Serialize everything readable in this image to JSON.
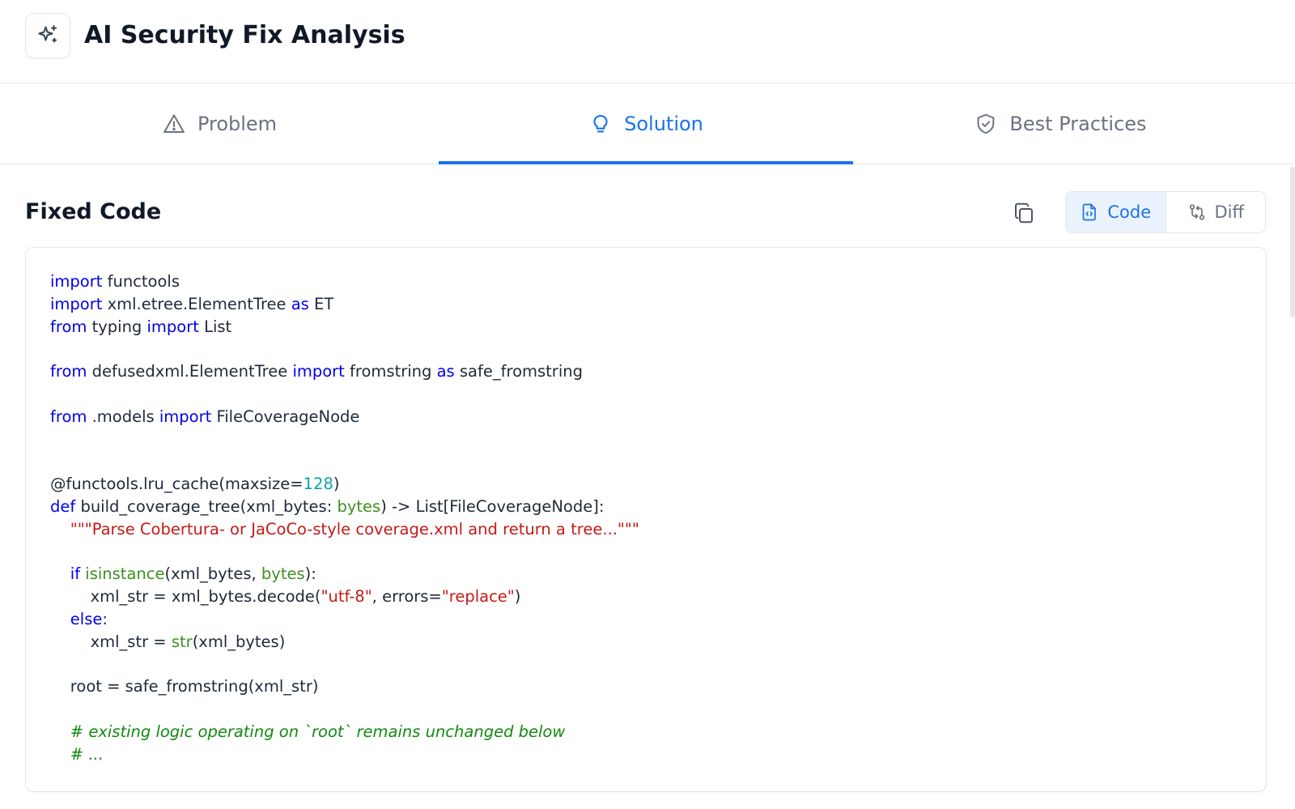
{
  "header": {
    "title": "AI Security Fix Analysis",
    "icon": "sparkle-icon"
  },
  "tabs": [
    {
      "label": "Problem",
      "icon": "warning-triangle-icon",
      "active": false
    },
    {
      "label": "Solution",
      "icon": "lightbulb-icon",
      "active": true
    },
    {
      "label": "Best Practices",
      "icon": "shield-check-icon",
      "active": false
    }
  ],
  "fixed_code": {
    "title": "Fixed Code",
    "copy_icon": "copy-icon",
    "view_toggle": [
      {
        "label": "Code",
        "icon": "file-code-icon",
        "active": true
      },
      {
        "label": "Diff",
        "icon": "git-compare-icon",
        "active": false
      }
    ],
    "lines": [
      [
        {
          "t": "import",
          "c": "kw"
        },
        {
          "t": " functools"
        }
      ],
      [
        {
          "t": "import",
          "c": "kw"
        },
        {
          "t": " xml.etree.ElementTree "
        },
        {
          "t": "as",
          "c": "kw"
        },
        {
          "t": " ET"
        }
      ],
      [
        {
          "t": "from",
          "c": "kw"
        },
        {
          "t": " typing "
        },
        {
          "t": "import",
          "c": "kw"
        },
        {
          "t": " List"
        }
      ],
      [],
      [
        {
          "t": "from",
          "c": "kw"
        },
        {
          "t": " defusedxml.ElementTree "
        },
        {
          "t": "import",
          "c": "kw"
        },
        {
          "t": " fromstring "
        },
        {
          "t": "as",
          "c": "kw"
        },
        {
          "t": " safe_fromstring"
        }
      ],
      [],
      [
        {
          "t": "from",
          "c": "kw"
        },
        {
          "t": " .models "
        },
        {
          "t": "import",
          "c": "kw"
        },
        {
          "t": " FileCoverageNode"
        }
      ],
      [],
      [],
      [
        {
          "t": "@functools.lru_cache(maxsize="
        },
        {
          "t": "128",
          "c": "num"
        },
        {
          "t": ")"
        }
      ],
      [
        {
          "t": "def",
          "c": "kw"
        },
        {
          "t": " build_coverage_tree(xml_bytes: "
        },
        {
          "t": "bytes",
          "c": "bi"
        },
        {
          "t": ") -> List[FileCoverageNode]:"
        }
      ],
      [
        {
          "t": "    "
        },
        {
          "t": "\"\"\"Parse Cobertura- or JaCoCo-style coverage.xml and return a tree...\"\"\"",
          "c": "str"
        }
      ],
      [],
      [
        {
          "t": "    "
        },
        {
          "t": "if",
          "c": "kw"
        },
        {
          "t": " "
        },
        {
          "t": "isinstance",
          "c": "bi"
        },
        {
          "t": "(xml_bytes, "
        },
        {
          "t": "bytes",
          "c": "bi"
        },
        {
          "t": "):"
        }
      ],
      [
        {
          "t": "        xml_str = xml_bytes.decode("
        },
        {
          "t": "\"utf-8\"",
          "c": "str"
        },
        {
          "t": ", errors="
        },
        {
          "t": "\"replace\"",
          "c": "str"
        },
        {
          "t": ")"
        }
      ],
      [
        {
          "t": "    "
        },
        {
          "t": "else",
          "c": "kw"
        },
        {
          "t": ":"
        }
      ],
      [
        {
          "t": "        xml_str = "
        },
        {
          "t": "str",
          "c": "bi"
        },
        {
          "t": "(xml_bytes)"
        }
      ],
      [],
      [
        {
          "t": "    root = safe_fromstring(xml_str)"
        }
      ],
      [],
      [
        {
          "t": "    "
        },
        {
          "t": "# existing logic operating on `root` remains unchanged below",
          "c": "cmt"
        }
      ],
      [
        {
          "t": "    "
        },
        {
          "t": "# ...",
          "c": "cmt"
        }
      ]
    ]
  }
}
